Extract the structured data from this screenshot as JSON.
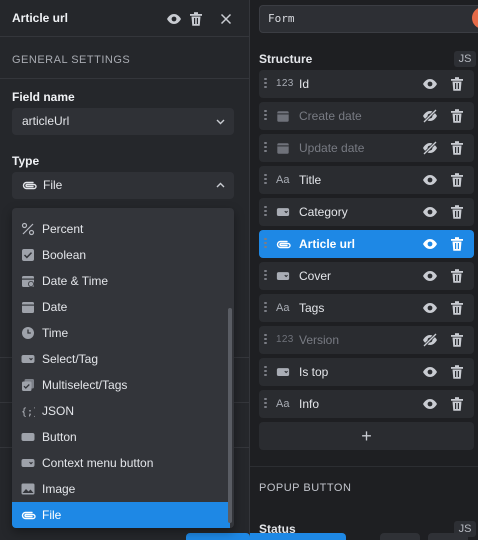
{
  "right_panel": {
    "form_input": "Form",
    "structure_title": "Structure",
    "js_badge": "JS",
    "fields": [
      {
        "label": "Id",
        "type_icon": "123",
        "hidden": false,
        "active": false
      },
      {
        "label": "Create date",
        "type_icon": "calendar",
        "hidden": true,
        "active": false
      },
      {
        "label": "Update date",
        "type_icon": "calendar",
        "hidden": true,
        "active": false
      },
      {
        "label": "Title",
        "type_icon": "Aa",
        "hidden": false,
        "active": false
      },
      {
        "label": "Category",
        "type_icon": "tag",
        "hidden": false,
        "active": false
      },
      {
        "label": "Article url",
        "type_icon": "clip",
        "hidden": false,
        "active": true
      },
      {
        "label": "Cover",
        "type_icon": "tag",
        "hidden": false,
        "active": false
      },
      {
        "label": "Tags",
        "type_icon": "Aa",
        "hidden": false,
        "active": false
      },
      {
        "label": "Version",
        "type_icon": "123",
        "hidden": true,
        "active": false
      },
      {
        "label": "Is top",
        "type_icon": "tag",
        "hidden": false,
        "active": false
      },
      {
        "label": "Info",
        "type_icon": "Aa",
        "hidden": false,
        "active": false
      }
    ],
    "add_label": "+",
    "popup_button_title": "POPUP BUTTON",
    "status_label": "Status",
    "status_js": "JS"
  },
  "left_panel": {
    "title": "Article url",
    "general_settings": "GENERAL SETTINGS",
    "field_name_label": "Field name",
    "field_name_value": "articleUrl",
    "type_label": "Type",
    "type_value": "File"
  },
  "dropdown": {
    "items": [
      {
        "label": "Percent",
        "icon": "percent-icon"
      },
      {
        "label": "Boolean",
        "icon": "checkbox-icon"
      },
      {
        "label": "Date & Time",
        "icon": "calendar-clock-icon"
      },
      {
        "label": "Date",
        "icon": "calendar-icon"
      },
      {
        "label": "Time",
        "icon": "clock-icon"
      },
      {
        "label": "Select/Tag",
        "icon": "tag-icon"
      },
      {
        "label": "Multiselect/Tags",
        "icon": "multi-checkbox-icon"
      },
      {
        "label": "JSON",
        "icon": "json-icon"
      },
      {
        "label": "Button",
        "icon": "button-icon"
      },
      {
        "label": "Context menu button",
        "icon": "menu-button-icon"
      },
      {
        "label": "Image",
        "icon": "image-icon"
      },
      {
        "label": "File",
        "icon": "paperclip-icon"
      }
    ],
    "selected": "File"
  },
  "colors": {
    "accent": "#1e88e5",
    "panel_bg": "#25272b",
    "row_bg": "#2a2c30"
  }
}
